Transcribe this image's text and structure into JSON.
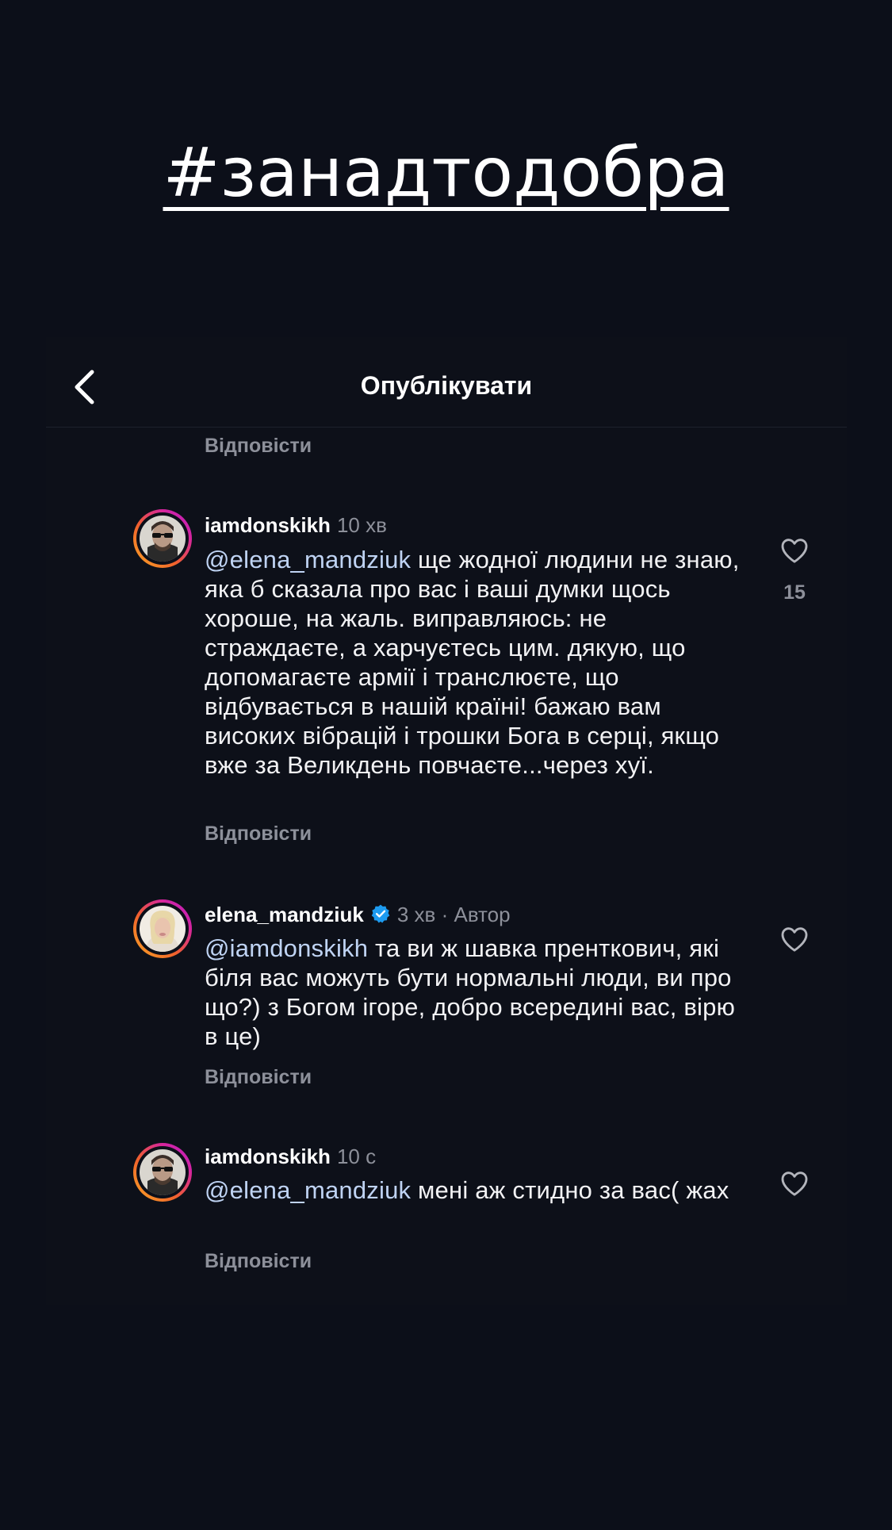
{
  "story": {
    "hashtag": "#занадтодобра"
  },
  "header": {
    "title": "Опублікувати"
  },
  "reply_label": "Відповісти",
  "comments": [
    {
      "username": "iamdonskikh",
      "time": "10 хв",
      "mention": "@elena_mandziuk",
      "text": " ще жодної людини не знаю, яка б сказала про вас і ваші думки щось хороше, на жаль. виправляюсь: не страждаєте, а харчуєтесь цим. дякую, що допомагаєте армії і транслюєте, що відбувається в нашій країні! бажаю вам високих вібрацій і трошки Бога в серці, якщо вже за Великдень повчаєте...через хуї.",
      "likes": "15"
    },
    {
      "username": "elena_mandziuk",
      "verified": true,
      "time": "3 хв",
      "author_label": "· Автор",
      "mention": "@iamdonskikh",
      "text": " та ви ж шавка пренткович, які біля вас можуть бути нормальні люди, ви про що?) з Богом ігоре, добро всередині вас, вірю в це)"
    },
    {
      "username": "iamdonskikh",
      "time": "10 с",
      "mention": "@elena_mandziuk",
      "text": " мені аж стидно за вас( жах"
    }
  ],
  "colors": {
    "background": "#0c0f19",
    "muted_text": "#8d909a",
    "mention": "#bfd3f3",
    "verified_badge": "#1d9bf0"
  },
  "icons": {
    "back": "chevron-left-icon",
    "like": "heart-outline-icon",
    "verified": "verified-badge-icon"
  }
}
